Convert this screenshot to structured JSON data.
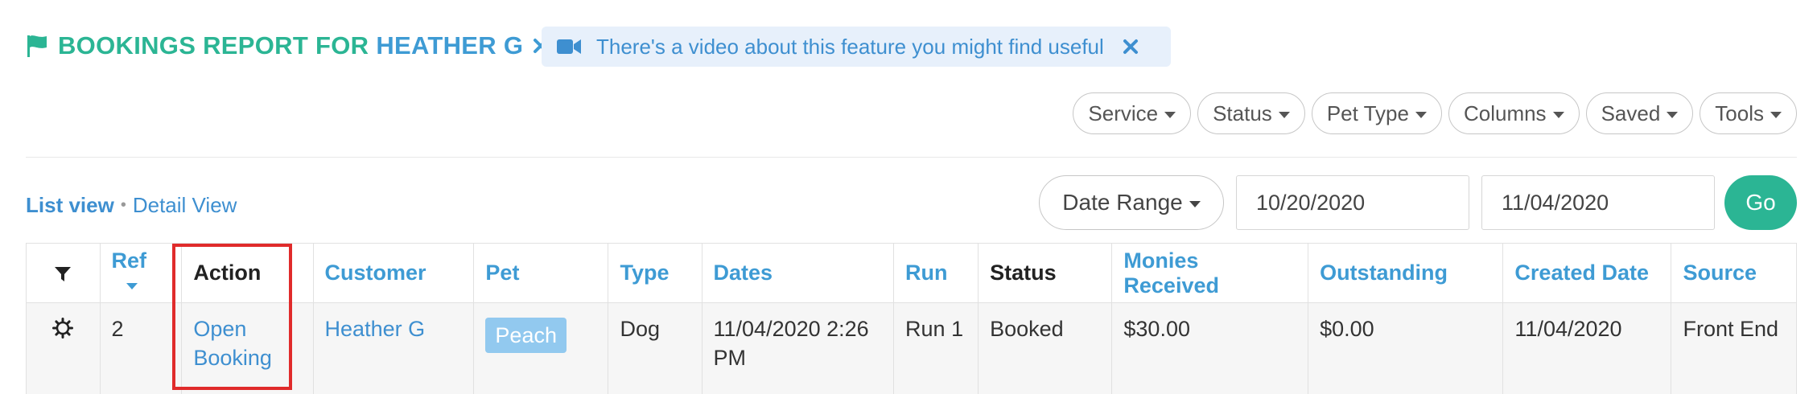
{
  "header": {
    "title_part1": "BOOKINGS REPORT FOR",
    "title_part2": "HEATHER G",
    "icon": "flag-icon",
    "close_icon": "times-icon"
  },
  "banner": {
    "icon": "video-camera-icon",
    "text": "There's a video about this feature you might find useful",
    "close_icon": "times-icon"
  },
  "filters": [
    {
      "label": "Service"
    },
    {
      "label": "Status"
    },
    {
      "label": "Pet Type"
    },
    {
      "label": "Columns"
    },
    {
      "label": "Saved"
    },
    {
      "label": "Tools"
    }
  ],
  "views": {
    "active": "List view",
    "separator": "•",
    "inactive": "Detail View"
  },
  "date_filter": {
    "range_label": "Date Range",
    "start_date": "10/20/2020",
    "end_date": "11/04/2020",
    "go_label": "Go"
  },
  "table": {
    "columns": [
      {
        "label": "",
        "icon": "filter-icon"
      },
      {
        "label": "Ref",
        "sortable": true
      },
      {
        "label": "Action"
      },
      {
        "label": "Customer"
      },
      {
        "label": "Pet"
      },
      {
        "label": "Type"
      },
      {
        "label": "Dates"
      },
      {
        "label": "Run"
      },
      {
        "label": "Status"
      },
      {
        "label": "Monies Received"
      },
      {
        "label": "Outstanding"
      },
      {
        "label": "Created Date"
      },
      {
        "label": "Source"
      }
    ],
    "rows": [
      {
        "icon": "gear-icon",
        "ref": "2",
        "action": "Open Booking",
        "customer": "Heather G",
        "pet": "Peach",
        "type": "Dog",
        "dates": "11/04/2020 2:26 PM",
        "run": "Run 1",
        "status": "Booked",
        "monies_received": "$30.00",
        "outstanding": "$0.00",
        "created_date": "11/04/2020",
        "source": "Front End"
      }
    ]
  },
  "colors": {
    "brand_green": "#2bb594",
    "link_blue": "#3e8fd0",
    "highlight_red": "#e02b2b",
    "banner_bg": "#e7f0fb",
    "pet_tag_bg": "#92c9ef"
  }
}
